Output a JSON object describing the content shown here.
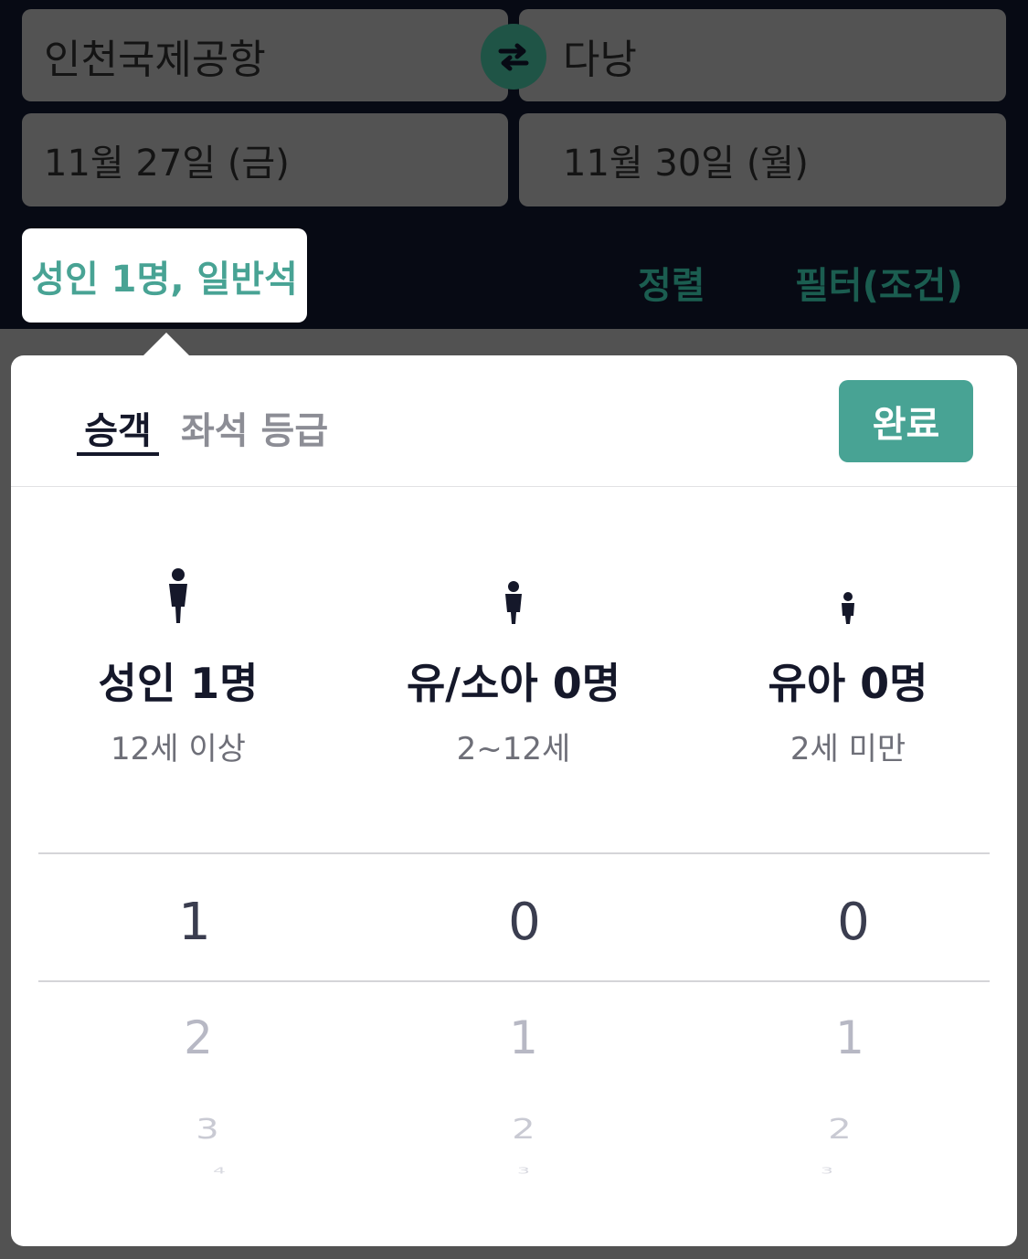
{
  "route": {
    "origin": "인천국제공항",
    "destination": "다낭"
  },
  "dates": {
    "departure": "11월 27일 (금)",
    "return": "11월 30일 (월)"
  },
  "toolbar": {
    "passenger_summary": "성인 1명, 일반석",
    "sort": "정렬",
    "filter": "필터(조건)"
  },
  "sheet": {
    "tabs": [
      {
        "label": "승객",
        "active": true
      },
      {
        "label": "좌석 등급",
        "active": false
      }
    ],
    "done": "완료",
    "categories": [
      {
        "count_label": "성인 1명",
        "age_label": "12세 이상"
      },
      {
        "count_label": "유/소아 0명",
        "age_label": "2~12세"
      },
      {
        "count_label": "유아 0명",
        "age_label": "2세 미만"
      }
    ],
    "pickers": [
      {
        "selected": "1",
        "next": [
          "2",
          "3",
          "4"
        ]
      },
      {
        "selected": "0",
        "next": [
          "1",
          "2",
          "3"
        ]
      },
      {
        "selected": "0",
        "next": [
          "1",
          "2",
          "3"
        ]
      }
    ]
  },
  "colors": {
    "accent": "#48a394",
    "topbar": "#070a14",
    "text": "#15182a"
  },
  "icons": {
    "swap": "swap-icon",
    "adult": "adult-icon",
    "child": "child-icon",
    "infant": "infant-icon"
  }
}
